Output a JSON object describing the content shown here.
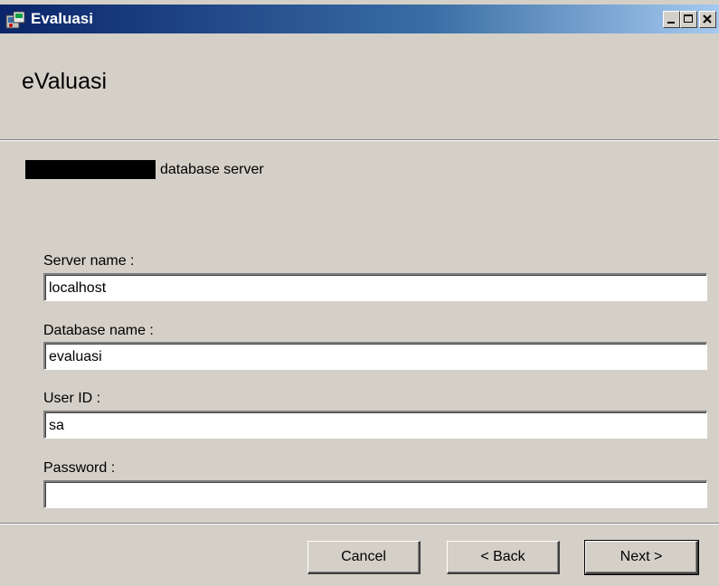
{
  "window": {
    "title": "Evaluasi",
    "controls": {
      "minimize": "minimize-icon",
      "maximize": "maximize-icon",
      "close": "close-icon"
    }
  },
  "header": {
    "title": "eValuasi"
  },
  "intro": {
    "subtitle": "database server"
  },
  "form": {
    "server_name": {
      "label": "Server name :",
      "value": "localhost"
    },
    "database_name": {
      "label": "Database name :",
      "value": "evaluasi"
    },
    "user_id": {
      "label": "User ID :",
      "value": "sa"
    },
    "password": {
      "label": "Password :",
      "value": ""
    }
  },
  "buttons": {
    "cancel": "Cancel",
    "back": "< Back",
    "next": "Next >"
  }
}
